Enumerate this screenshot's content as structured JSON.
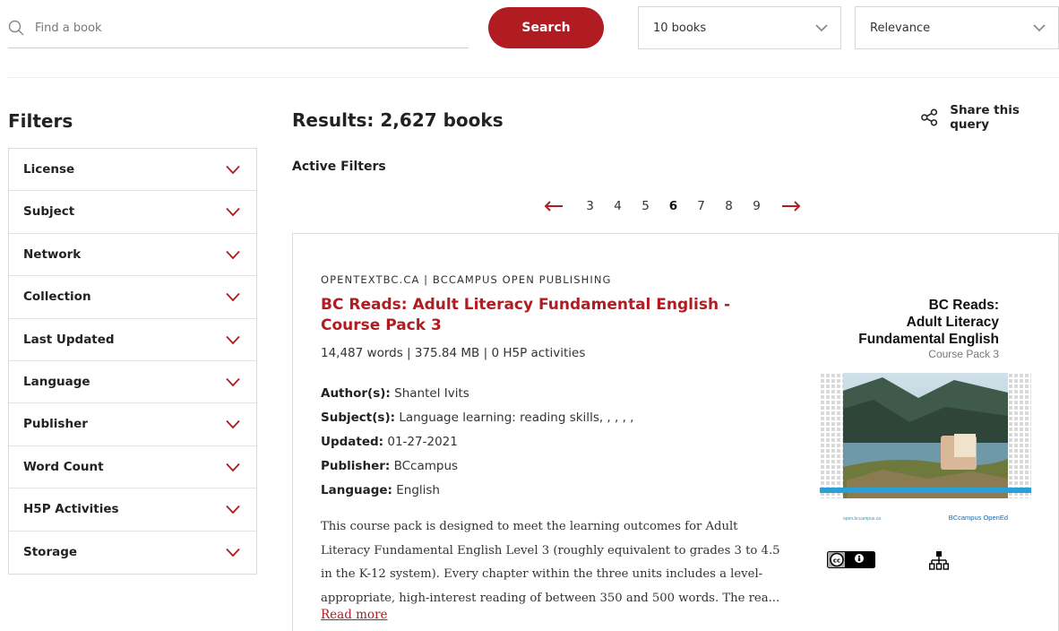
{
  "search": {
    "placeholder": "Find a book",
    "value": "",
    "button_label": "Search",
    "icon": "search-icon"
  },
  "per_page": {
    "selected": "10 books"
  },
  "sort": {
    "selected": "Relevance"
  },
  "sidebar": {
    "title": "Filters",
    "items": [
      {
        "label": "License"
      },
      {
        "label": "Subject"
      },
      {
        "label": "Network"
      },
      {
        "label": "Collection"
      },
      {
        "label": "Last Updated"
      },
      {
        "label": "Language"
      },
      {
        "label": "Publisher"
      },
      {
        "label": "Word Count"
      },
      {
        "label": "H5P Activities"
      },
      {
        "label": "Storage"
      }
    ]
  },
  "results": {
    "title": "Results: 2,627 books",
    "share_label": "Share this query",
    "active_filters_label": "Active Filters"
  },
  "pagination": {
    "pages": [
      "3",
      "4",
      "5",
      "6",
      "7",
      "8",
      "9"
    ],
    "current": "6"
  },
  "book": {
    "network": "OPENTEXTBC.CA | BCCAMPUS OPEN PUBLISHING",
    "title": "BC Reads: Adult Literacy Fundamental English - Course Pack 3",
    "stats": "14,487 words | 375.84 MB | 0 H5P activities",
    "authors_label": "Author(s):",
    "authors": "Shantel Ivits",
    "subjects_label": "Subject(s):",
    "subjects": "Language learning: reading skills, , , , ,",
    "updated_label": "Updated:",
    "updated": "01-27-2021",
    "publisher_label": "Publisher:",
    "publisher": "BCcampus",
    "language_label": "Language:",
    "language": "English",
    "description": "This course pack is designed to meet the learning outcomes for Adult Literacy Fundamental English Level 3 (roughly equivalent to grades 3 to 4.5 in the K-12 system). Every chapter within the three units includes a level-appropriate, high-interest reading of between 350 and 500 words. The rea...",
    "read_more": "Read more",
    "cover": {
      "line1": "BC Reads:",
      "line2": "Adult Literacy",
      "line3": "Fundamental English",
      "subtitle": "Course Pack 3",
      "footer_left": "open.bccampus.ca",
      "footer_right": "BCcampus OpenEd"
    },
    "license_icon": "cc-by-icon",
    "network_icon": "sitemap-icon"
  },
  "colors": {
    "accent": "#b01c21",
    "border": "#dcdcdc",
    "text": "#222222"
  }
}
